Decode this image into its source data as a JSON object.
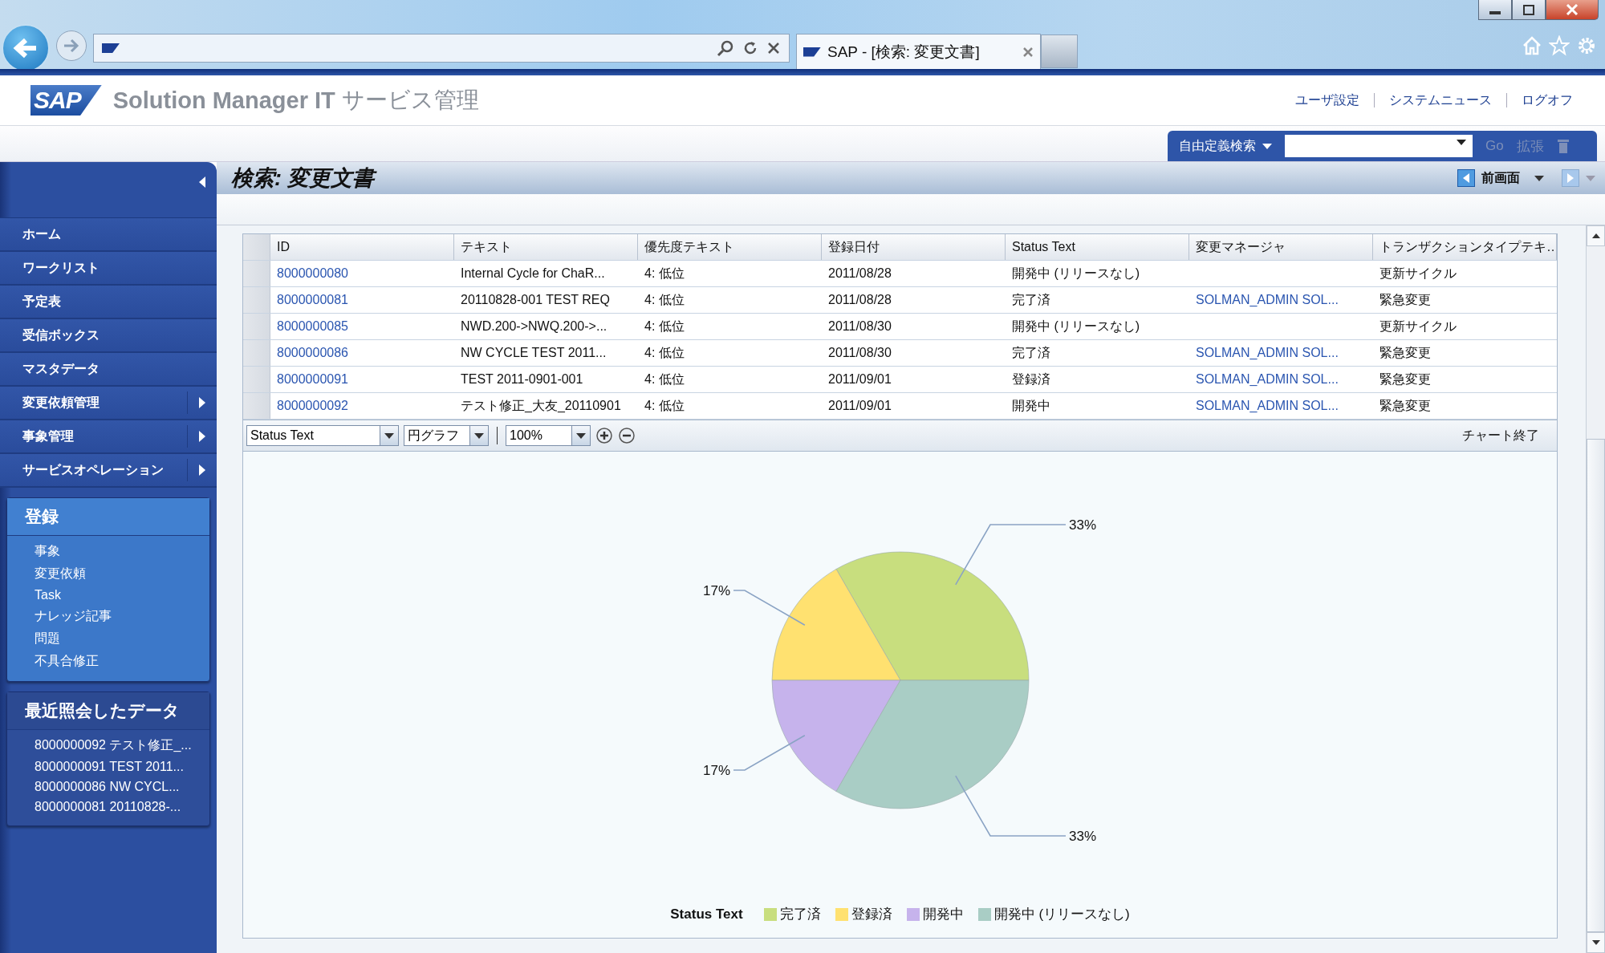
{
  "browser": {
    "tab_title": "SAP - [検索: 変更文書]"
  },
  "header": {
    "logo": "SAP",
    "product": "Solution Manager IT",
    "product_suffix": "サービス管理",
    "links": [
      "ユーザ設定",
      "システムニュース",
      "ログオフ"
    ]
  },
  "search": {
    "menu": "自由定義検索",
    "go": "Go",
    "expand": "拡張"
  },
  "page": {
    "title": "検索: 変更文書",
    "back": "前画面"
  },
  "sidebar": {
    "nav": [
      {
        "label": "ホーム",
        "has_submenu": false
      },
      {
        "label": "ワークリスト",
        "has_submenu": false
      },
      {
        "label": "予定表",
        "has_submenu": false
      },
      {
        "label": "受信ボックス",
        "has_submenu": false
      },
      {
        "label": "マスタデータ",
        "has_submenu": false
      },
      {
        "label": "変更依頼管理",
        "has_submenu": true
      },
      {
        "label": "事象管理",
        "has_submenu": true
      },
      {
        "label": "サービスオペレーション",
        "has_submenu": true
      }
    ],
    "create": {
      "title": "登録",
      "items": [
        "事象",
        "変更依頼",
        "Task",
        "ナレッジ記事",
        "問題",
        "不具合修正"
      ]
    },
    "recent": {
      "title": "最近照会したデータ",
      "items": [
        "8000000092 テスト修正_...",
        "8000000091 TEST 2011...",
        "8000000086 NW CYCL...",
        "8000000081 20110828-..."
      ]
    }
  },
  "table": {
    "columns": [
      "ID",
      "テキスト",
      "優先度テキスト",
      "登録日付",
      "Status Text",
      "変更マネージャ",
      "トランザクションタイプテキ…"
    ],
    "rows": [
      {
        "id": "8000000080",
        "text": "Internal Cycle for ChaR...",
        "priority": "4: 低位",
        "date": "2011/08/28",
        "status": "開発中 (リリースなし)",
        "type": "更新サイクル"
      },
      {
        "id": "8000000081",
        "text": "20110828-001 TEST REQ",
        "priority": "4: 低位",
        "date": "2011/08/28",
        "status": "完了済",
        "manager": "SOLMAN_ADMIN SOL...",
        "type": "緊急変更"
      },
      {
        "id": "8000000085",
        "text": "NWD.200->NWQ.200->...",
        "priority": "4: 低位",
        "date": "2011/08/30",
        "status": "開発中 (リリースなし)",
        "type": "更新サイクル"
      },
      {
        "id": "8000000086",
        "text": "NW CYCLE TEST 2011...",
        "priority": "4: 低位",
        "date": "2011/08/30",
        "status": "完了済",
        "manager": "SOLMAN_ADMIN SOL...",
        "type": "緊急変更"
      },
      {
        "id": "8000000091",
        "text": "TEST 2011-0901-001",
        "priority": "4: 低位",
        "date": "2011/09/01",
        "status": "登録済",
        "manager": "SOLMAN_ADMIN SOL...",
        "type": "緊急変更"
      },
      {
        "id": "8000000092",
        "text": "テスト修正_大友_20110901",
        "priority": "4: 低位",
        "date": "2011/09/01",
        "status": "開発中",
        "manager": "SOLMAN_ADMIN SOL...",
        "type": "緊急変更"
      }
    ]
  },
  "chart_toolbar": {
    "field": "Status Text",
    "chart_type": "円グラフ",
    "zoom": "100%",
    "close": "チャート終了"
  },
  "chart": {
    "legend_title": "Status Text",
    "chart_data": {
      "type": "pie",
      "categories": [
        "完了済",
        "登録済",
        "開発中",
        "開発中 (リリースなし)"
      ],
      "values": [
        33.33,
        16.67,
        16.67,
        33.33
      ],
      "legend": "bottom",
      "colors": [
        "#c8de7e",
        "#ffe170",
        "#c6b3ec",
        "#a9cdc5"
      ],
      "value_labels": [
        "33%",
        "17%",
        "17%",
        "33%"
      ]
    }
  }
}
